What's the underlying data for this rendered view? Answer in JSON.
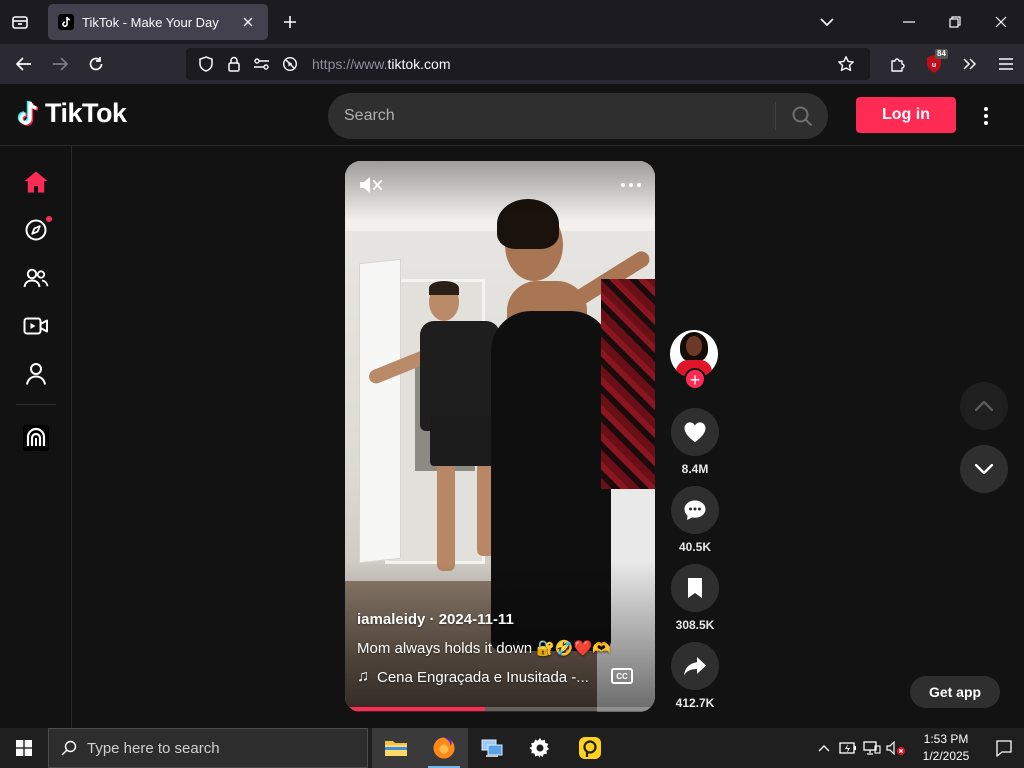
{
  "browser": {
    "tab_title": "TikTok - Make Your Day",
    "url_prefix": "https://www.",
    "url_domain": "tiktok.com",
    "extension_badge": "84"
  },
  "header": {
    "logo_text": "TikTok",
    "search_placeholder": "Search",
    "login_label": "Log in"
  },
  "sidebar": {
    "items": [
      {
        "icon": "home-icon",
        "active": true
      },
      {
        "icon": "explore-icon",
        "dot": true
      },
      {
        "icon": "following-icon"
      },
      {
        "icon": "live-icon"
      },
      {
        "icon": "profile-icon"
      },
      {
        "icon": "arch-icon"
      }
    ]
  },
  "video": {
    "author": "iamaleidy",
    "date": "2024-11-11",
    "caption": "Mom always holds it down 🔐🤣❤️🫶",
    "music": "Cena Engraçada e Inusitada -...",
    "cc_label": "CC",
    "progress": 0.45
  },
  "actions": {
    "likes": "8.4M",
    "comments": "40.5K",
    "saves": "308.5K",
    "shares": "412.7K"
  },
  "get_app_label": "Get app",
  "taskbar": {
    "search_placeholder": "Type here to search",
    "time": "1:53 PM",
    "date": "1/2/2025"
  },
  "colors": {
    "brand": "#fe2c55",
    "page_bg": "#121212",
    "surface": "#2f2f2f"
  }
}
